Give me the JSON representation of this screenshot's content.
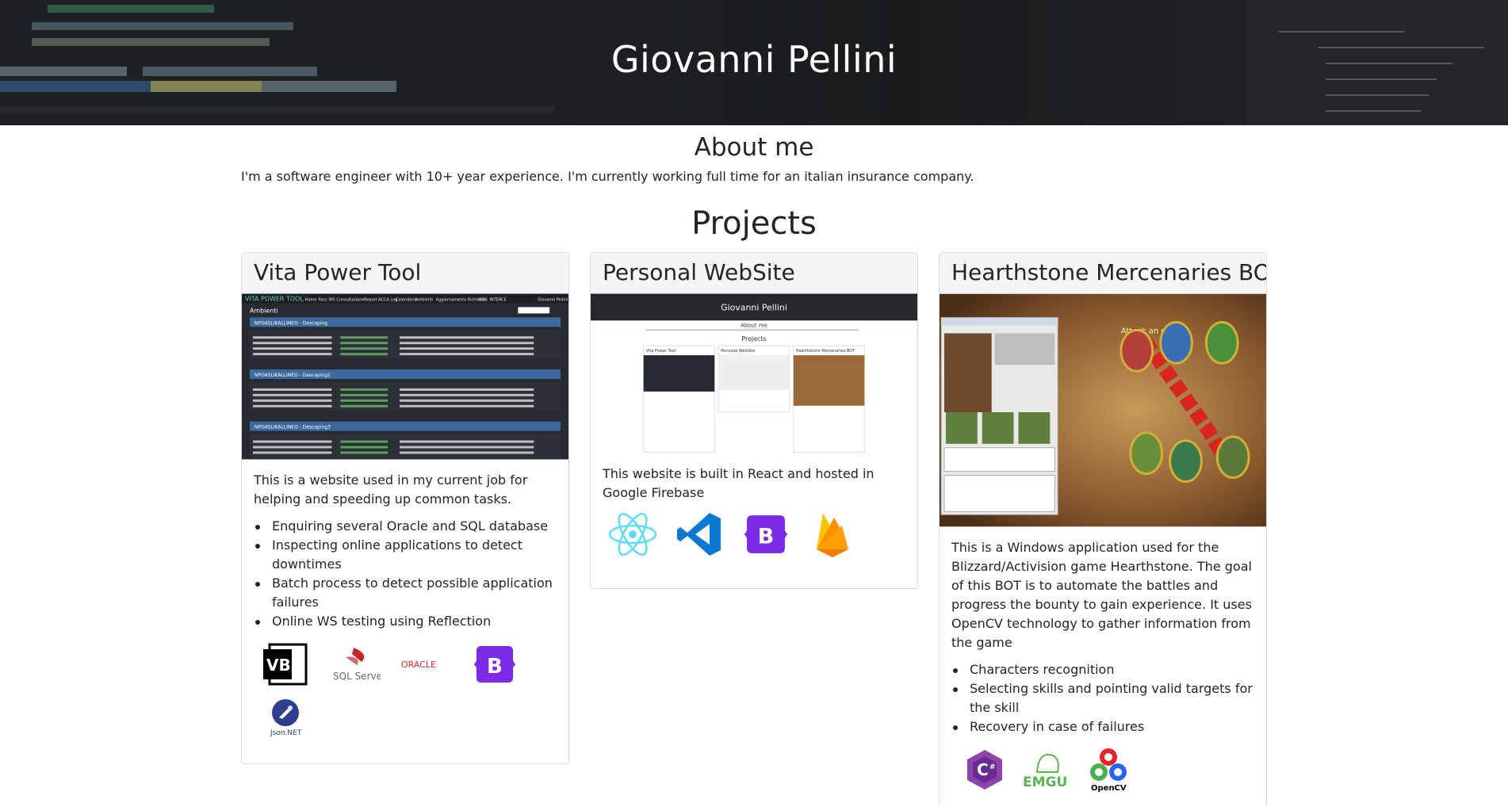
{
  "header": {
    "name": "Giovanni Pellini"
  },
  "about": {
    "title": "About me",
    "text": "I'm a software engineer with 10+ year experience. I'm currently working full time for an italian insurance company."
  },
  "projects": {
    "title": "Projects",
    "items": [
      {
        "title": "Vita Power Tool",
        "description": "This is a website used in my current job for helping and speeding up common tasks.",
        "features": [
          "Enquiring several Oracle and SQL database",
          "Inspecting online applications to detect downtimes",
          "Batch process to detect possible application failures",
          "Online WS testing using Reflection"
        ],
        "tech_icons": [
          "vb-icon",
          "sql-server-icon",
          "oracle-icon",
          "bootstrap-icon",
          "json-net-icon"
        ],
        "tech_labels": {
          "sql": "SQL Server",
          "oracle": "ORACLE",
          "json": "Json.NET",
          "vb": "VB"
        },
        "screenshot": {
          "app_name": "VITA POWER TOOL",
          "menu": [
            "Home",
            "Pass",
            "WS",
            "Consultazione",
            "Report",
            "ACCA Log",
            "Calendario",
            "Ambienti",
            "Aggiornamento Richieste",
            "WSS",
            "INTERCE"
          ],
          "user": "Giovanni Pellini",
          "page_title": "Ambienti",
          "env_titles": [
            "NPOASLIKALLINEO - Descaping",
            "NPOASLIKALLINEO - Descaping2",
            "NPOASLIKALLINEO - Descaping3"
          ]
        }
      },
      {
        "title": "Personal WebSite",
        "description": "This website is built in React and hosted in Google Firebase",
        "tech_icons": [
          "react-icon",
          "vscode-icon",
          "bootstrap-icon",
          "firebase-icon"
        ]
      },
      {
        "title": "Hearthstone Mercenaries BOT",
        "description": "This is a Windows application used for the Blizzard/Activision game Hearthstone. The goal of this BOT is to automate the battles and progress the bounty to gain experience. It uses OpenCV technology to gather information from the game",
        "features": [
          "Characters recognition",
          "Selecting skills and pointing valid targets for the skill",
          "Recovery in case of failures"
        ],
        "tech_icons": [
          "csharp-icon",
          "emgu-icon",
          "opencv-icon"
        ],
        "tech_labels": {
          "emgu": "EMGU",
          "opencv": "OpenCV"
        },
        "screenshot": {
          "game_caption": "Attack an enemy"
        }
      }
    ]
  },
  "colors": {
    "header_bg": "#1d2023",
    "card_header_bg": "#f5f5f5",
    "bootstrap_purple": "#7c2ae8",
    "react_cyan": "#61dafb",
    "vscode_blue": "#0a78d4",
    "firebase_orange": "#f6a821"
  }
}
